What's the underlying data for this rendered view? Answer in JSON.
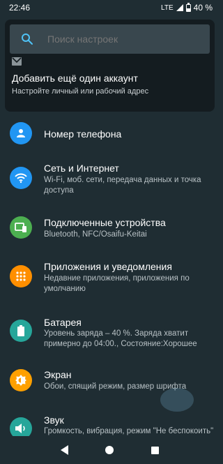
{
  "status": {
    "time": "22:46",
    "network": "LTE",
    "battery": "40 %"
  },
  "search": {
    "placeholder": "Поиск настроек"
  },
  "account": {
    "title": "Добавить ещё один аккаунт",
    "subtitle": "Настройте личный или рабочий адрес"
  },
  "items": [
    {
      "title": "Номер телефона",
      "subtitle": "",
      "icon": "person-icon",
      "color": "#2196f3"
    },
    {
      "title": "Сеть и Интернет",
      "subtitle": "Wi-Fi, моб. сети, передача данных и точка доступа",
      "icon": "wifi-icon",
      "color": "#2196f3"
    },
    {
      "title": "Подключенные устройства",
      "subtitle": "Bluetooth, NFC/Osaifu-Keitai",
      "icon": "devices-icon",
      "color": "#4caf50"
    },
    {
      "title": "Приложения и уведомления",
      "subtitle": "Недавние приложения, приложения по умолчанию",
      "icon": "apps-icon",
      "color": "#ff8f00"
    },
    {
      "title": "Батарея",
      "subtitle": "Уровень заряда – 40 %. Заряда хватит примерно до 04:00., Состояние:Хорошее",
      "icon": "battery-icon",
      "color": "#26a69a"
    },
    {
      "title": "Экран",
      "subtitle": "Обои, спящий режим, размер шрифта",
      "icon": "brightness-icon",
      "color": "#ffa000"
    },
    {
      "title": "Звук",
      "subtitle": "Громкость, вибрация, режим \"Не беспокоить\"",
      "icon": "volume-icon",
      "color": "#26a69a"
    }
  ]
}
